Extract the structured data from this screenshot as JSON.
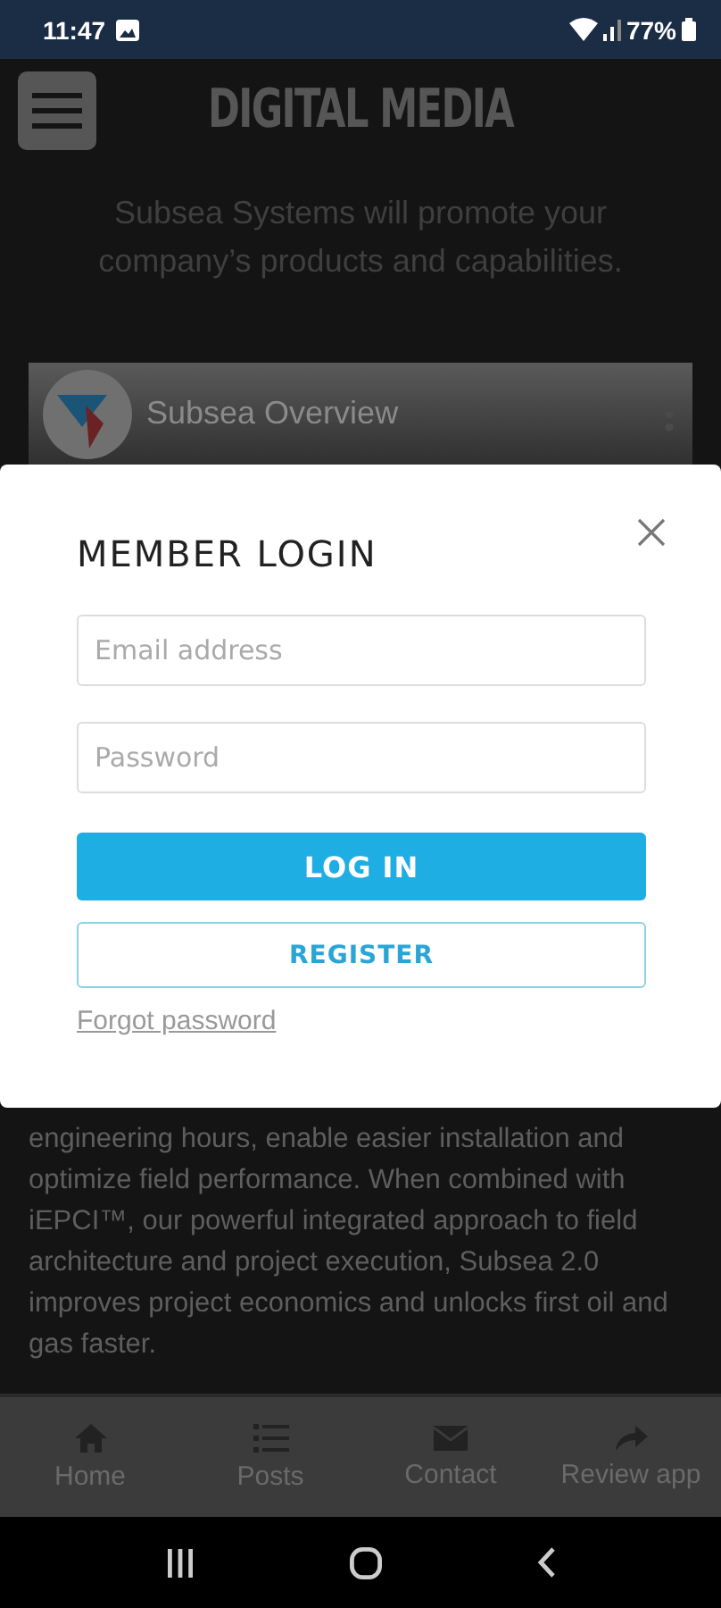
{
  "status_bar": {
    "time": "11:47",
    "battery": "77%"
  },
  "header": {
    "title": "DIGITAL MEDIA"
  },
  "intro": "Subsea Systems will promote your company’s products and capabilities.",
  "video": {
    "title": "Subsea Overview"
  },
  "login": {
    "title": "MEMBER LOGIN",
    "email": {
      "placeholder": "Email address"
    },
    "password": {
      "placeholder": "Password"
    },
    "login_button": "LOG IN",
    "register_button": "REGISTER",
    "forgot_link": "Forgot password"
  },
  "body_text": "engineering hours, enable easier installation and optimize field performance. When combined with iEPCI™, our powerful integrated approach to field architecture and project execution, Subsea 2.0 improves project economics and unlocks first oil and gas faster.",
  "bottom_nav": [
    {
      "label": "Home",
      "kind": "home"
    },
    {
      "label": "Posts",
      "kind": "list"
    },
    {
      "label": "Contact",
      "kind": "mail"
    },
    {
      "label": "Review app",
      "kind": "share"
    }
  ]
}
